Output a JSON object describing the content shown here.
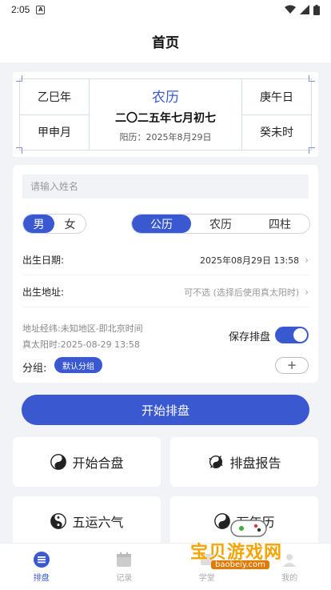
{
  "status_bar": {
    "time": "2:05",
    "notification": "A"
  },
  "header": {
    "title": "首页"
  },
  "calendar": {
    "year_pillar": "乙巳年",
    "month_pillar": "甲申月",
    "day_pillar": "庚午日",
    "hour_pillar": "癸未时",
    "lunar_title": "农历",
    "lunar_date": "二〇二五年七月初七",
    "solar_date": "阳历：2025年8月29日"
  },
  "form": {
    "name_placeholder": "请输入姓名",
    "gender": {
      "male": "男",
      "female": "女",
      "selected": "男"
    },
    "calendar_type": {
      "options": [
        "公历",
        "农历",
        "四柱"
      ],
      "selected": "公历"
    },
    "birth_date": {
      "label": "出生日期:",
      "value": "2025年08月29日 13:58"
    },
    "birth_place": {
      "label": "出生地址:",
      "value": "可不选 (选择后使用真太阳时)"
    },
    "geo_info": "地址经纬:未知地区-即北京时间",
    "true_solar": "真太阳时:2025-08-29 13:58",
    "save_label": "保存排盘",
    "save_enabled": true,
    "group_label": "分组:",
    "group_default": "默认分组",
    "add_symbol": "+"
  },
  "start_button": "开始排盘",
  "features": [
    {
      "label": "开始合盘",
      "icon": "yin-yang-icon"
    },
    {
      "label": "排盘报告",
      "icon": "yin-yang-swirl-icon"
    },
    {
      "label": "五运六气",
      "icon": "yin-yang-icon"
    },
    {
      "label": "万年历",
      "icon": "yin-yang-icon"
    }
  ],
  "tabs": [
    {
      "label": "排盘",
      "icon": "chart-icon",
      "active": true
    },
    {
      "label": "记录",
      "icon": "calendar-icon",
      "active": false
    },
    {
      "label": "学堂",
      "icon": "book-icon",
      "active": false
    },
    {
      "label": "我的",
      "icon": "user-icon",
      "active": false
    }
  ],
  "watermark": {
    "text": "宝贝游戏网",
    "url": "baobeiy.com"
  },
  "colors": {
    "accent": "#3a59d1",
    "background": "#f2f3f7"
  }
}
